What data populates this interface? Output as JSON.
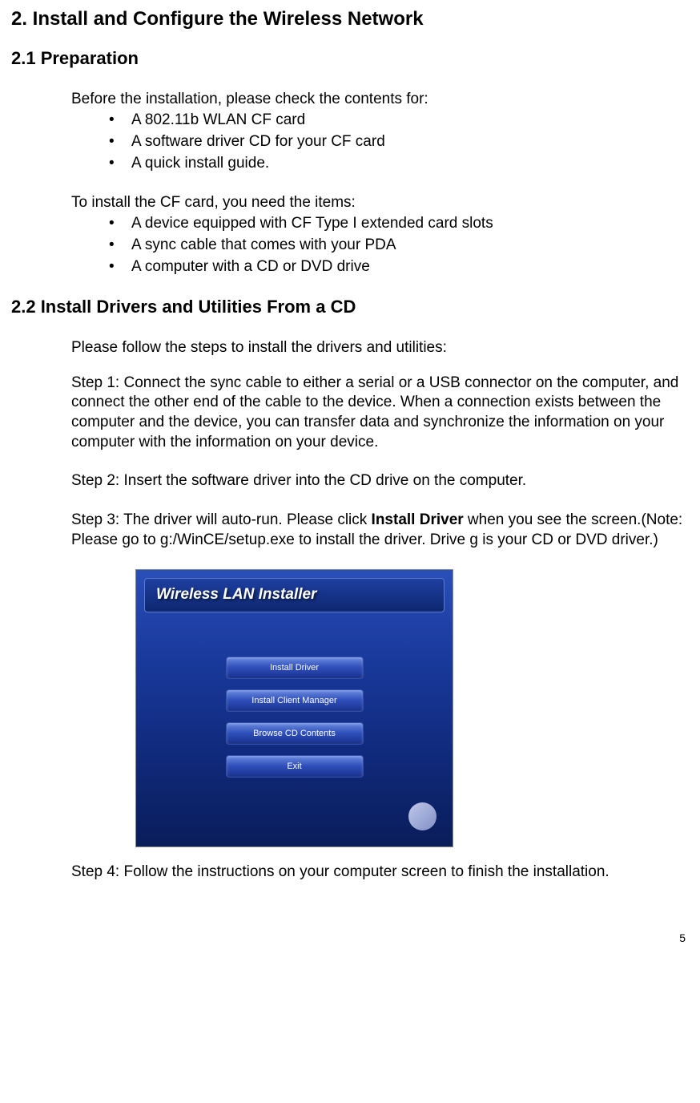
{
  "heading_main": "2. Install and Configure the Wireless Network",
  "section_2_1": {
    "title": "2.1 Preparation",
    "intro1": "Before the installation, please check the contents for:",
    "bullets1": [
      "A 802.11b WLAN CF card",
      "A software driver CD for your CF card",
      "A quick install guide."
    ],
    "intro2": "To install the CF card, you need the items:",
    "bullets2": [
      "A device equipped with CF Type I extended card slots",
      "A sync cable that comes with your PDA",
      "A computer with a CD or DVD drive"
    ]
  },
  "section_2_2": {
    "title": "2.2   Install Drivers and Utilities From a CD",
    "intro": "Please follow the steps to install the drivers and utilities:",
    "step1": "Step 1: Connect the sync cable to either a serial or a USB connector on the computer, and connect the other end of the cable to the device. When a connection exists between the computer and the device, you can transfer data and synchronize the information on your computer with the information on your device.",
    "step2": "Step 2: Insert the software driver into the CD drive on the computer.",
    "step3_a": "Step 3: The driver will auto-run. Please click ",
    "step3_bold": "Install Driver",
    "step3_b": " when you see the screen.(Note: Please go to g:/WinCE/setup.exe to install the driver. Drive g is your CD or DVD driver.)",
    "installer": {
      "title": "Wireless LAN Installer",
      "buttons": [
        "Install Driver",
        "Install Client Manager",
        "Browse  CD Contents",
        "Exit"
      ]
    },
    "step4": "Step 4: Follow the instructions on your computer screen to finish the installation."
  },
  "page_number": "5"
}
